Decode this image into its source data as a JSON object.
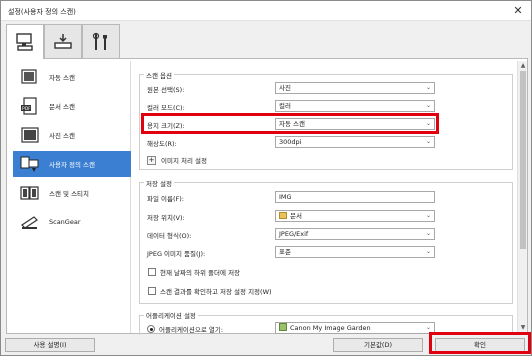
{
  "window": {
    "title": "설정(사용자 정의 스캔)",
    "close_glyph": "✕"
  },
  "tabs": [
    {
      "name": "scan-tab",
      "icon": "scanner-pc-icon",
      "active": true
    },
    {
      "name": "scan-to-pc-tab",
      "icon": "scan-arrow-icon",
      "active": false
    },
    {
      "name": "general-settings-tab",
      "icon": "tools-icon",
      "active": false
    }
  ],
  "sidebar": {
    "items": [
      {
        "label": "자동 스캔",
        "icon": "auto-scan-icon",
        "active": false
      },
      {
        "label": "문서 스캔",
        "icon": "pdf-document-icon",
        "active": false
      },
      {
        "label": "사진 스캔",
        "icon": "photo-icon",
        "active": false
      },
      {
        "label": "사용자 정의 스캔",
        "icon": "custom-scan-icon",
        "active": true
      },
      {
        "label": "스캔 및 스티치",
        "icon": "stitch-icon",
        "active": false
      },
      {
        "label": "ScanGear",
        "icon": "scangear-icon",
        "active": false
      }
    ]
  },
  "scan_options": {
    "title": "스캔 옵션",
    "source_label": "원본 선택(S):",
    "source_value": "사진",
    "color_label": "컬러 모드(C):",
    "color_value": "컬러",
    "paper_label": "용지 크기(Z):",
    "paper_value": "자동 스캔",
    "resolution_label": "해상도(R):",
    "resolution_value": "300dpi",
    "image_settings_label": "이미지 처리 설정",
    "plus_glyph": "+"
  },
  "save_settings": {
    "title": "저장 설정",
    "filename_label": "파일 이름(F):",
    "filename_value": "IMG",
    "location_label": "저장 위치(V):",
    "location_value": "문서",
    "format_label": "데이터 형식(O):",
    "format_value": "JPEG/Exif",
    "quality_label": "JPEG 이미지 품질(J):",
    "quality_value": "표준",
    "subfolder_label": "현재 날짜의 하위 폴더에 저장",
    "confirm_label": "스캔 결과를 확인하고 저장 설정 지정(W)"
  },
  "app_settings": {
    "title": "어플리케이션 설정",
    "open_with_label": "어플리케이션으로 열기:",
    "open_with_value": "Canon My Image Garden"
  },
  "buttons": {
    "instructions": "사용 설명(I)",
    "defaults": "기본값(D)",
    "ok": "확인"
  },
  "colors": {
    "highlight": "#e0000e",
    "active_item": "#3a7fd1"
  }
}
